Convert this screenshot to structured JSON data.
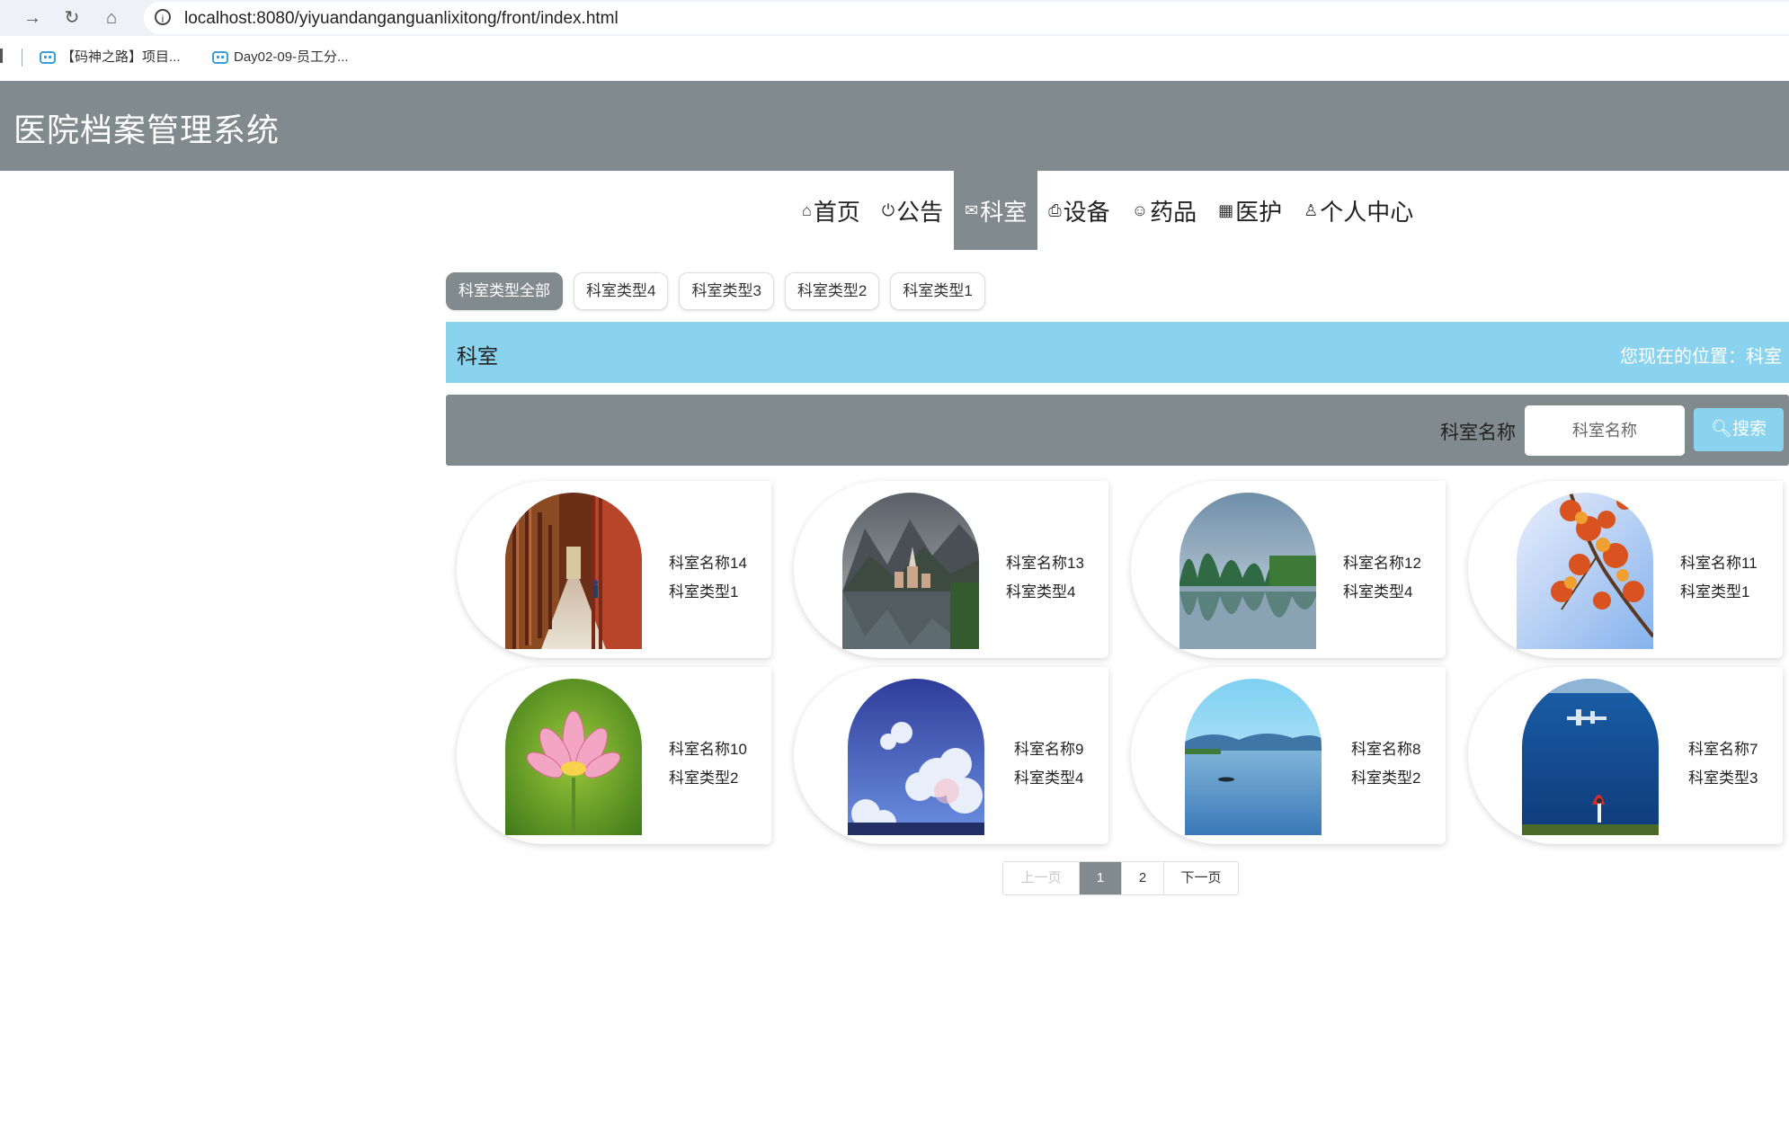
{
  "browser": {
    "url": "localhost:8080/yiyuandanganguanlixitong/front/index.html",
    "bookmarks": [
      "【码神之路】项目...",
      "Day02-09-员工分..."
    ]
  },
  "header": {
    "title": "医院档案管理系统"
  },
  "nav": {
    "items": [
      {
        "label": "首页",
        "icon": "home-icon"
      },
      {
        "label": "公告",
        "icon": "power-icon"
      },
      {
        "label": "科室",
        "icon": "mail-icon",
        "active": true
      },
      {
        "label": "设备",
        "icon": "printer-icon"
      },
      {
        "label": "药品",
        "icon": "smile-icon"
      },
      {
        "label": "医护",
        "icon": "grid-icon"
      },
      {
        "label": "个人中心",
        "icon": "user-icon"
      }
    ]
  },
  "categories": [
    "科室类型全部",
    "科室类型4",
    "科室类型3",
    "科室类型2",
    "科室类型1"
  ],
  "breadcrumb": {
    "title": "科室",
    "position": "您现在的位置：科室"
  },
  "search": {
    "label": "科室名称",
    "placeholder": "科室名称",
    "button": "搜索"
  },
  "items": [
    {
      "name": "科室名称14",
      "type": "科室类型1",
      "image": "corridor"
    },
    {
      "name": "科室名称13",
      "type": "科室类型4",
      "image": "mountain-village"
    },
    {
      "name": "科室名称12",
      "type": "科室类型4",
      "image": "karst-river"
    },
    {
      "name": "科室名称11",
      "type": "科室类型1",
      "image": "autumn-leaves"
    },
    {
      "name": "科室名称10",
      "type": "科室类型2",
      "image": "lotus"
    },
    {
      "name": "科室名称9",
      "type": "科室类型4",
      "image": "clouds-sky"
    },
    {
      "name": "科室名称8",
      "type": "科室类型2",
      "image": "lake-boat"
    },
    {
      "name": "科室名称7",
      "type": "科室类型3",
      "image": "blue-sea"
    }
  ],
  "pagination": {
    "prev": "上一页",
    "pages": [
      "1",
      "2"
    ],
    "current": "1",
    "next": "下一页"
  },
  "colors": {
    "primary": "#818a8d",
    "accent": "#8ad3ee"
  }
}
